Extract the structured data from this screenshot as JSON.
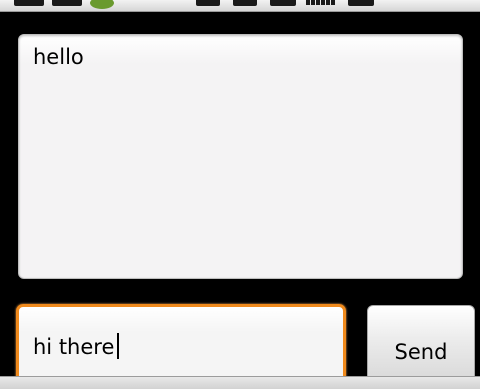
{
  "message_area": {
    "text": "hello"
  },
  "input": {
    "value": "hi there"
  },
  "send_button": {
    "label": "Send"
  },
  "colors": {
    "focus_border": "#f08a1c",
    "background": "#000000",
    "field_fill": "#f4f3f4"
  },
  "status_bar": {
    "icons": [
      "notification-icon",
      "usb-icon",
      "android-icon",
      "sound-icon",
      "sync-icon",
      "network-icon",
      "signal-icon",
      "battery-icon"
    ]
  }
}
